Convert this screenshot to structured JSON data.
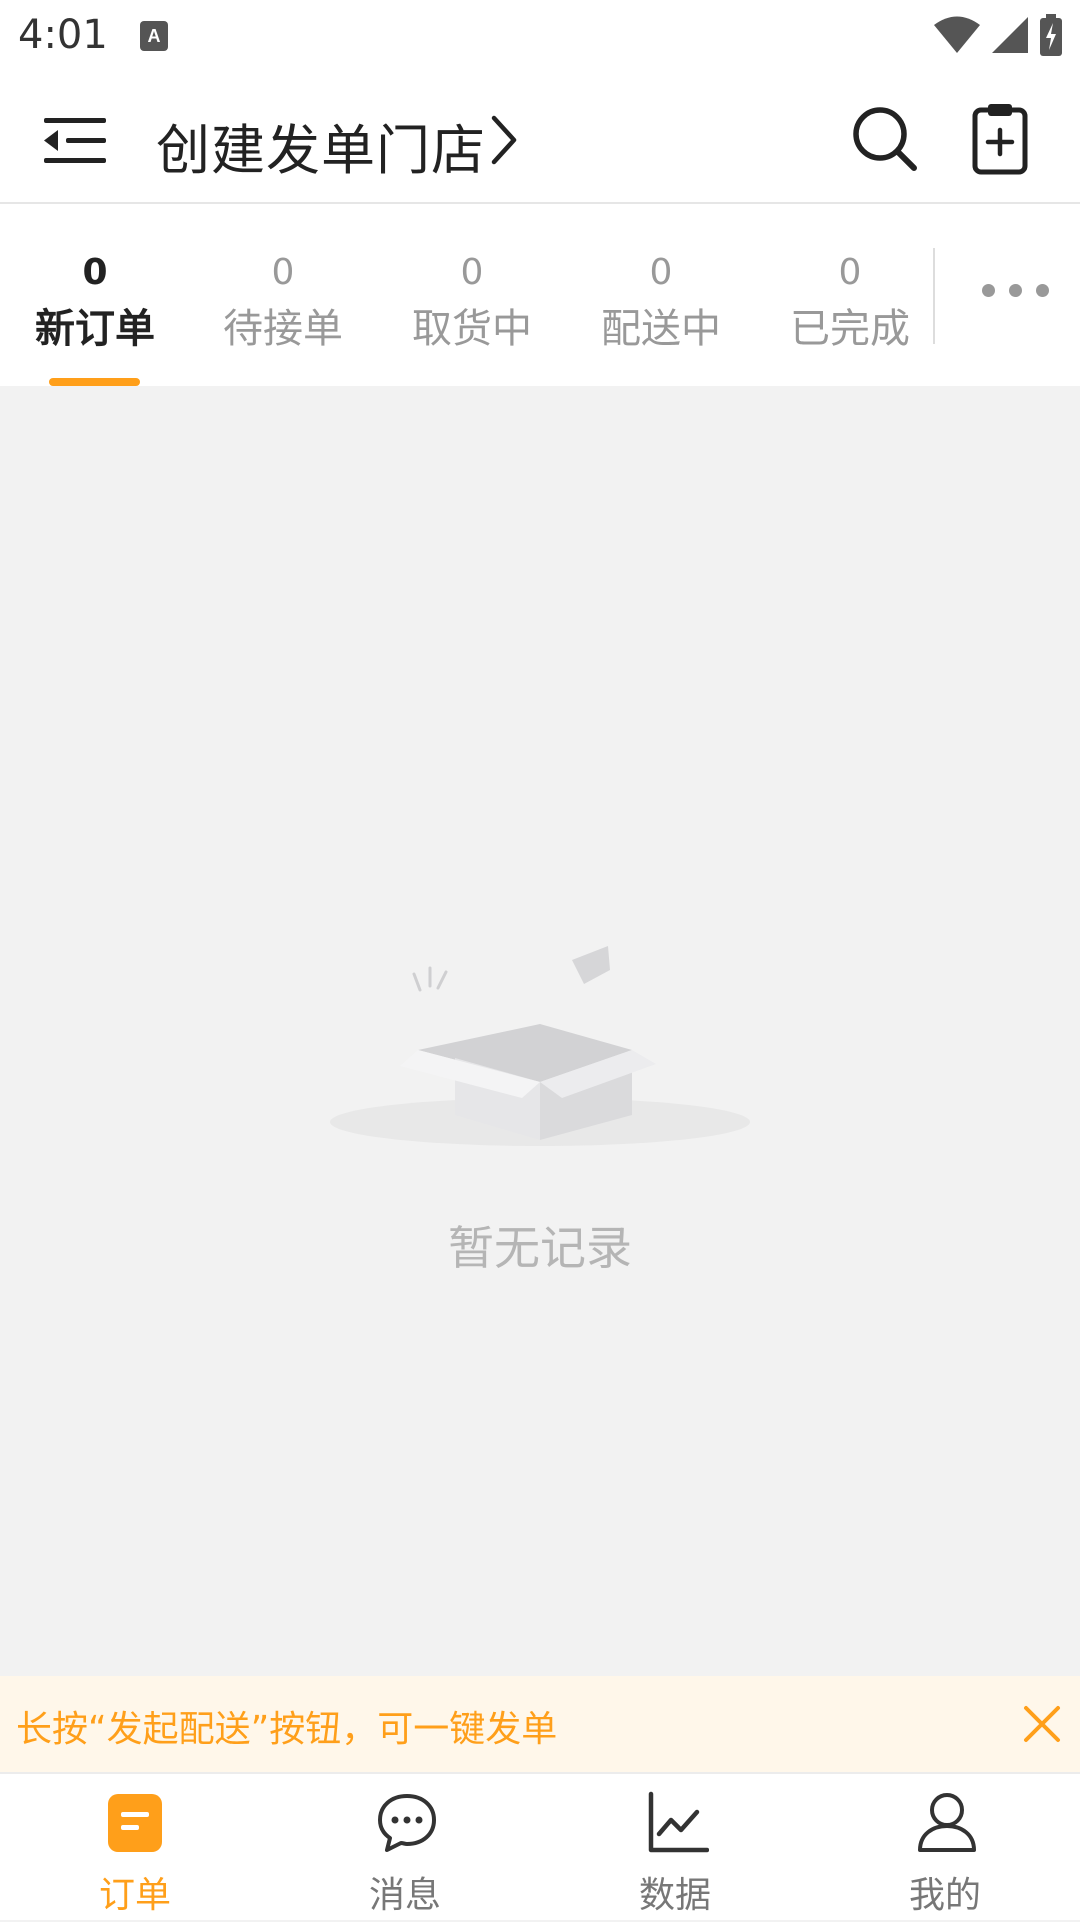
{
  "status_bar": {
    "time": "4:01",
    "icons": [
      "keyboard-a-icon",
      "wifi-icon",
      "cell-signal-icon",
      "battery-charging-icon"
    ]
  },
  "header": {
    "title": "创建发单门店",
    "icons": [
      "menu-collapse-icon",
      "chevron-right-icon",
      "search-icon",
      "clipboard-add-icon"
    ]
  },
  "tabs": [
    {
      "count": "0",
      "label": "新订单",
      "active": true
    },
    {
      "count": "0",
      "label": "待接单",
      "active": false
    },
    {
      "count": "0",
      "label": "取货中",
      "active": false
    },
    {
      "count": "0",
      "label": "配送中",
      "active": false
    },
    {
      "count": "0",
      "label": "已完成",
      "active": false
    }
  ],
  "more_icon": "more-horizontal-icon",
  "empty_state": {
    "text": "暂无记录",
    "icon": "empty-box-icon"
  },
  "tip": {
    "text": "长按“发起配送”按钮，可一键发单",
    "close_icon": "close-icon"
  },
  "bottom_nav": [
    {
      "label": "订单",
      "icon": "order-icon",
      "active": true
    },
    {
      "label": "消息",
      "icon": "message-icon",
      "active": false
    },
    {
      "label": "数据",
      "icon": "chart-icon",
      "active": false
    },
    {
      "label": "我的",
      "icon": "profile-icon",
      "active": false
    }
  ],
  "colors": {
    "accent": "#ff9f1a",
    "tip_background": "#fff7ea",
    "page_background": "#f2f2f2"
  }
}
